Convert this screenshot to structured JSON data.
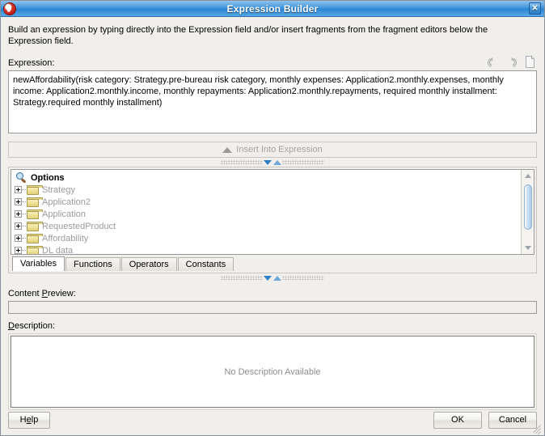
{
  "window": {
    "title": "Expression Builder",
    "app_icon": "app-logo-icon",
    "close_label": "✕"
  },
  "intro": {
    "text": "Build an expression by typing directly into the Expression field and/or insert fragments from the fragment editors below the Expression field."
  },
  "expression": {
    "label": "Expression:",
    "value": "newAffordability(risk category: Strategy.pre-bureau risk category, monthly expenses: Application2.monthly.expenses, monthly income: Application2.monthly.income, monthly repayments: Application2.monthly.repayments, required monthly installment: Strategy.required monthly installment)",
    "tools": [
      {
        "name": "undo-icon",
        "title": "Undo"
      },
      {
        "name": "redo-icon",
        "title": "Redo"
      },
      {
        "name": "new-document-icon",
        "title": "New"
      }
    ]
  },
  "insert": {
    "label": "Insert Into Expression",
    "enabled": false
  },
  "splitter": {
    "collapse_down": "▼",
    "collapse_up": "▲"
  },
  "tree": {
    "root": {
      "label": "Options",
      "icon": "search-icon"
    },
    "nodes": [
      {
        "label": "Strategy",
        "expanded": false
      },
      {
        "label": "Application2",
        "expanded": false
      },
      {
        "label": "Application",
        "expanded": false
      },
      {
        "label": "RequestedProduct",
        "expanded": false
      },
      {
        "label": "Affordability",
        "expanded": false
      },
      {
        "label": "DL data",
        "expanded": false
      }
    ]
  },
  "tabs": [
    {
      "label": "Variables",
      "active": true
    },
    {
      "label": "Functions",
      "active": false
    },
    {
      "label": "Operators",
      "active": false
    },
    {
      "label": "Constants",
      "active": false
    }
  ],
  "content_preview": {
    "label_pre": "Content ",
    "label_mnemonic": "P",
    "label_post": "review:",
    "value": ""
  },
  "description": {
    "label_mnemonic": "D",
    "label_post": "escription:",
    "empty_text": "No Description Available"
  },
  "buttons": {
    "help": {
      "pre": "H",
      "mnemonic": "e",
      "post": "lp"
    },
    "help_label": "Help",
    "ok_label": "OK",
    "cancel_label": "Cancel"
  },
  "colors": {
    "title_bar": "#2c86d4",
    "dialog_bg": "#f0efeb",
    "field_bg": "#ffffff",
    "folder": "#e3d179",
    "disabled_text": "#a5a39d",
    "tree_text": "#9b9b9b"
  }
}
